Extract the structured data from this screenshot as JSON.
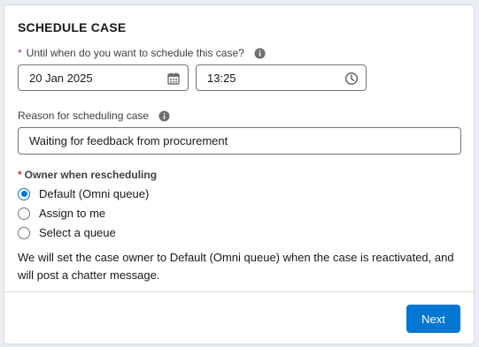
{
  "modal": {
    "title": "SCHEDULE CASE",
    "schedule_until": {
      "required_mark": "*",
      "label": "Until when do you want to schedule this case?",
      "date_value": "20 Jan 2025",
      "time_value": "13:25"
    },
    "reason": {
      "label": "Reason for scheduling case",
      "value": "Waiting for feedback from procurement"
    },
    "owner": {
      "required_mark": "*",
      "label": "Owner when rescheduling",
      "options": [
        {
          "label": "Default (Omni queue)",
          "selected": true
        },
        {
          "label": "Assign to me",
          "selected": false
        },
        {
          "label": "Select a queue",
          "selected": false
        }
      ]
    },
    "note": "We will set the case owner to Default (Omni queue) when the case is reactivated, and will post a chatter message.",
    "next_button": "Next"
  },
  "icons": {
    "info": "info-icon",
    "calendar": "calendar-icon",
    "clock": "clock-icon"
  },
  "colors": {
    "accent": "#0176d3",
    "required": "#c23934"
  }
}
